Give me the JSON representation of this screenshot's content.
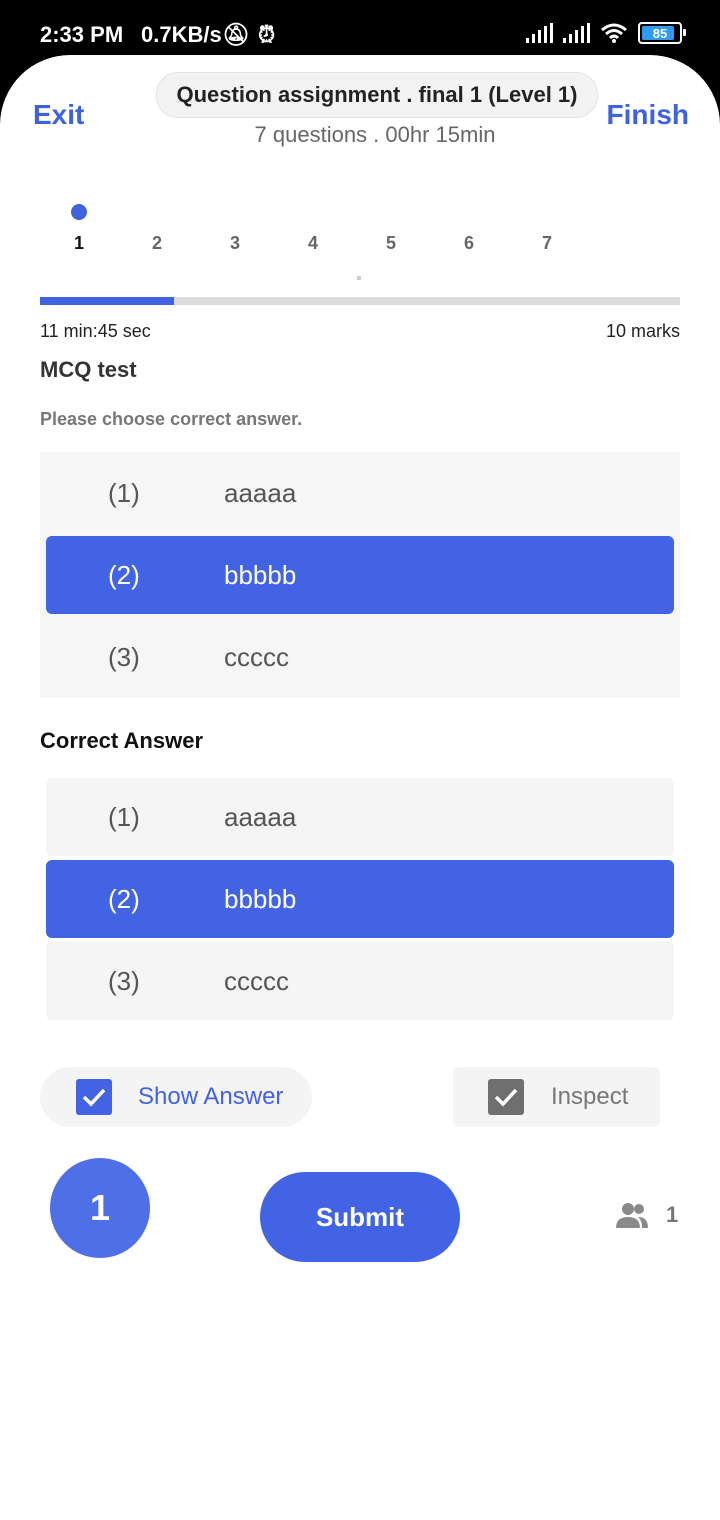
{
  "status_bar": {
    "time": "2:33 PM",
    "network_speed": "0.7KB/s",
    "battery_level": "85"
  },
  "header": {
    "exit_label": "Exit",
    "title": "Question assignment . final 1 (Level 1)",
    "finish_label": "Finish",
    "subtitle": "7 questions . 00hr 15min"
  },
  "question_nav": {
    "numbers": [
      "1",
      "2",
      "3",
      "4",
      "5",
      "6",
      "7"
    ],
    "current_index": 0
  },
  "progress_fraction": 0.21,
  "question": {
    "timer": "11 min:45 sec",
    "marks": "10 marks",
    "title": "MCQ test",
    "instruction": "Please choose correct answer."
  },
  "options": [
    {
      "index": "(1)",
      "text": "aaaaa",
      "selected": false
    },
    {
      "index": "(2)",
      "text": "bbbbb",
      "selected": true
    },
    {
      "index": "(3)",
      "text": "ccccc",
      "selected": false
    }
  ],
  "correct_answer": {
    "title": "Correct Answer",
    "options": [
      {
        "index": "(1)",
        "text": "aaaaa",
        "selected": false
      },
      {
        "index": "(2)",
        "text": "bbbbb",
        "selected": true
      },
      {
        "index": "(3)",
        "text": "ccccc",
        "selected": false
      }
    ]
  },
  "controls": {
    "show_answer_label": "Show Answer",
    "show_answer_checked": true,
    "inspect_label": "Inspect",
    "inspect_checked": true
  },
  "footer": {
    "count_badge": "1",
    "submit_label": "Submit",
    "participants_count": "1"
  },
  "colors": {
    "accent": "#4263e4",
    "header_link": "#3f63de"
  }
}
